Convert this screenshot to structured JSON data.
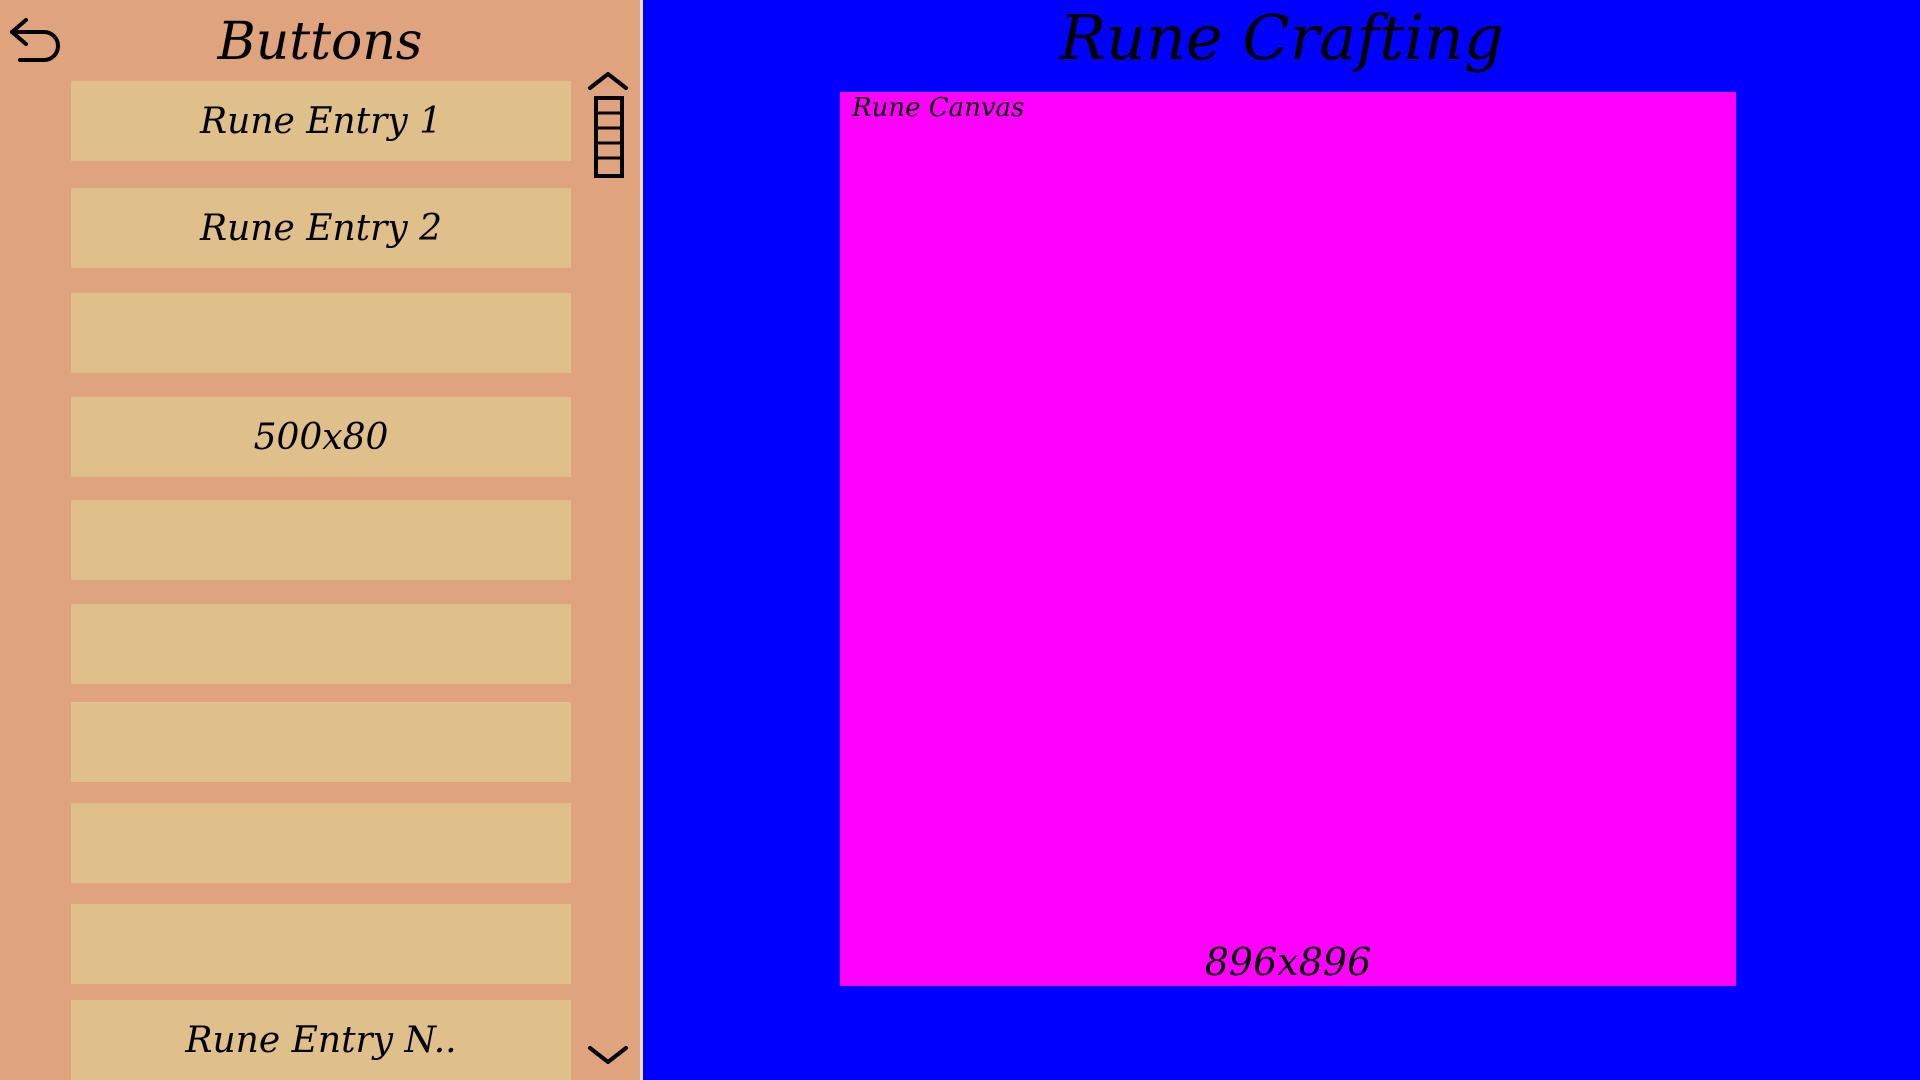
{
  "sidebar": {
    "title": "Buttons",
    "back_icon": "undo-arrow-icon",
    "entries": [
      {
        "label": "Rune Entry 1"
      },
      {
        "label": "Rune Entry 2"
      },
      {
        "label": ""
      },
      {
        "label": "500x80"
      },
      {
        "label": ""
      },
      {
        "label": ""
      },
      {
        "label": ""
      },
      {
        "label": ""
      },
      {
        "label": ""
      },
      {
        "label": "Rune Entry N.."
      }
    ],
    "scroll_up_icon": "chevron-up-icon",
    "scroll_down_icon": "chevron-down-icon",
    "scroll_thumb_icon": "scrollbar-thumb-icon"
  },
  "main": {
    "title": "Rune Crafting",
    "canvas": {
      "label": "Rune Canvas",
      "size_text": "896x896"
    }
  },
  "colors": {
    "sidebar_bg": "#dfa37e",
    "entry_bg": "#dfc08a",
    "main_bg": "#0000ff",
    "canvas_bg": "#ff00ff"
  }
}
